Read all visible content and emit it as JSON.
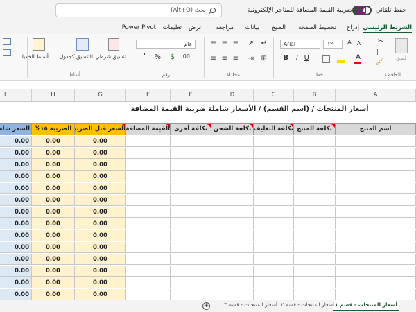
{
  "titlebar": {
    "autosave_label": "حفظ تلقائي",
    "document_title": "ضريبة القيمة المضافة للمتاجر الإلكترونية",
    "search_placeholder": "بحث (Alt+Q)"
  },
  "tabs": [
    {
      "label": "الشريط الرئيسي",
      "active": true
    },
    {
      "label": "إدراج"
    },
    {
      "label": "تخطيط الصفحة"
    },
    {
      "label": "الصيغ"
    },
    {
      "label": "بيانات"
    },
    {
      "label": "مراجعة"
    },
    {
      "label": "عرض"
    },
    {
      "label": "تعليمات"
    },
    {
      "label": "Power Pivot"
    }
  ],
  "ribbon": {
    "groups": {
      "clipboard": "الحافظة",
      "font": "خط",
      "alignment": "محاذاة",
      "number": "رقم",
      "styles": "أنماط"
    },
    "paste_label": "لصق",
    "font_name": "Arial",
    "font_size": "١٢",
    "number_format": "عام",
    "conditional_formatting": "تنسيق شرطي",
    "format_as_table": "التنسيق كجدول",
    "cell_styles": "أنماط الخلايا",
    "percent": "%",
    "comma": "٬"
  },
  "sheet": {
    "title": "أسعار المنتجات / (اسم القسم) / الأسعار شاملة ضريبة القيمة المضافة",
    "columns": [
      "A",
      "B",
      "C",
      "D",
      "E",
      "F",
      "G",
      "H",
      "I"
    ],
    "headers": {
      "A": "اسم المنتج",
      "B": "تكلفة المنتج",
      "C": "تكلفة التغليف",
      "D": "تكلفة الشحن",
      "E": "تكلفة أخرى",
      "F": "القيمة المضافة",
      "G": "السعر قبل الضريبة",
      "H": "الضريبة ١٥%",
      "I": "السعر شامل"
    },
    "row_value": "0.00",
    "row_count": 14,
    "colors": {
      "header_grey": "#d9d9d9",
      "header_yellow": "#ffc000",
      "yellow_fill": "#fff2cc",
      "blue_header": "#8fb4e3",
      "blue_fill": "#dde8f5",
      "red_marker": "#dd0000",
      "accent_green": "#185c37"
    }
  },
  "sheet_tabs": [
    {
      "label": "أسعار المنتجات - قسم ١",
      "active": true
    },
    {
      "label": "أسعار المنتجات - قسم ٢"
    },
    {
      "label": "أسعار المنتجات - قسم ٣"
    }
  ],
  "add_sheet_glyph": "+",
  "partial_left_column": "I"
}
